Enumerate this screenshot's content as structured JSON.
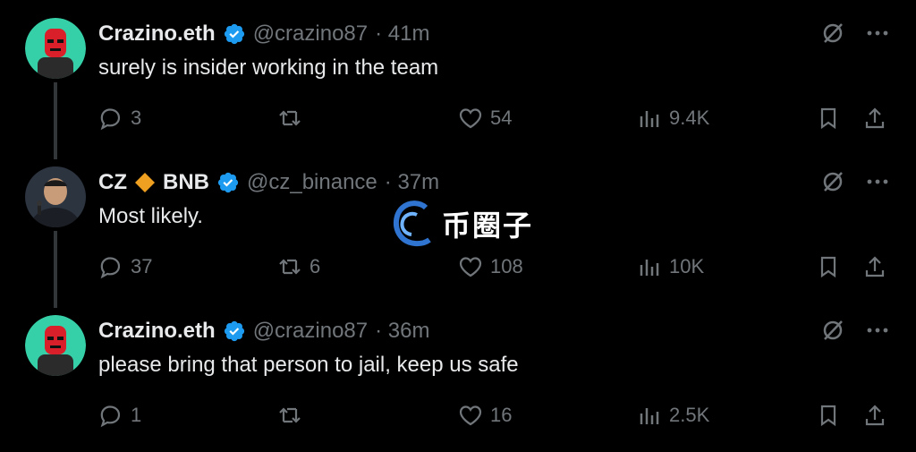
{
  "tweets": [
    {
      "name": "Crazino.eth",
      "handle": "@crazino87",
      "time": "· 41m",
      "text": "surely is insider working in the team",
      "replies": "3",
      "retweets": "",
      "likes": "54",
      "views": "9.4K",
      "avatar_icon": "red-masked-avatar",
      "verified": true
    },
    {
      "name": "CZ",
      "name_suffix": "BNB",
      "handle": "@cz_binance",
      "time": "· 37m",
      "text": "Most likely.",
      "replies": "37",
      "retweets": "6",
      "likes": "108",
      "views": "10K",
      "avatar_icon": "person-photo-avatar",
      "verified": true
    },
    {
      "name": "Crazino.eth",
      "handle": "@crazino87",
      "time": "· 36m",
      "text": "please bring that person to jail, keep us safe",
      "replies": "1",
      "retweets": "",
      "likes": "16",
      "views": "2.5K",
      "avatar_icon": "red-masked-avatar",
      "verified": true
    }
  ],
  "watermark": {
    "text": "币圈子"
  },
  "colors": {
    "background": "#000000",
    "text": "#e7e9ea",
    "muted": "#71767b",
    "verified": "#1d9bf0",
    "bnb": "#f0a020"
  }
}
